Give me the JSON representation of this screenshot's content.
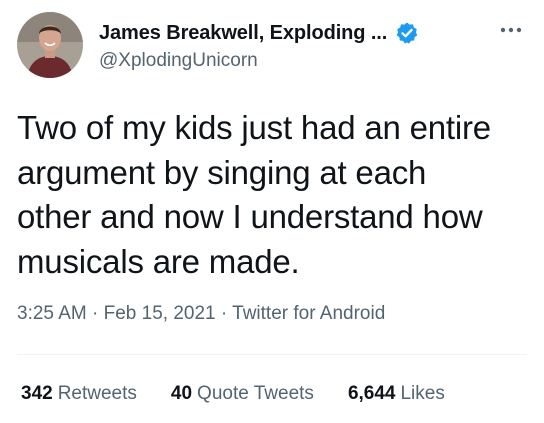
{
  "author": {
    "display_name": "James Breakwell, Exploding ...",
    "handle": "@XplodingUnicorn",
    "verified_icon": "verified-badge-icon",
    "avatar_icon": "avatar-photo"
  },
  "tweet": {
    "text_lines": [
      "Two of my kids just had an entire",
      "argument by singing at each",
      "other and now I understand how",
      "musicals are made."
    ]
  },
  "meta": {
    "time": "3:25 AM",
    "separator": "·",
    "date": "Feb 15, 2021",
    "source": "Twitter for Android"
  },
  "stats": [
    {
      "count": "342",
      "label": "Retweets"
    },
    {
      "count": "40",
      "label": "Quote Tweets"
    },
    {
      "count": "6,644",
      "label": "Likes"
    }
  ],
  "colors": {
    "text": "#0f1419",
    "secondary": "#536471",
    "verified": "#1d9bf0",
    "divider": "#eff3f4"
  }
}
